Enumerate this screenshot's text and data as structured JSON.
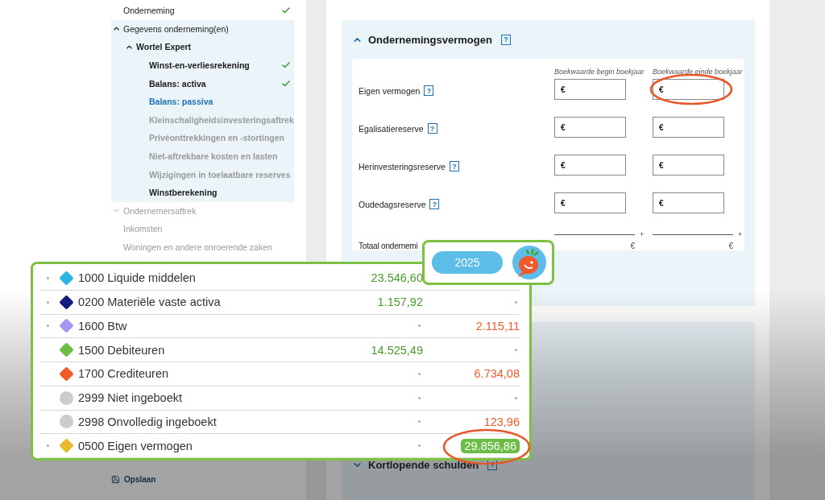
{
  "sidebar": {
    "items": [
      {
        "label": "Onderneming",
        "checked": true,
        "selected": false,
        "disabled": false
      },
      {
        "label": "Gegevens onderneming(en)",
        "expanded": true,
        "selected": false,
        "disabled": false,
        "children": [
          {
            "label": "Wortel Expert",
            "expanded": true,
            "selected": false,
            "disabled": false,
            "children": [
              {
                "label": "Winst-en-verliesrekening",
                "checked": true,
                "selected": false,
                "disabled": false
              },
              {
                "label": "Balans: activa",
                "checked": true,
                "selected": false,
                "disabled": false
              },
              {
                "label": "Balans: passiva",
                "checked": false,
                "selected": true,
                "disabled": false
              },
              {
                "label": "Kleinschaligheidsinvesteringsaftrek",
                "checked": false,
                "selected": false,
                "disabled": true
              },
              {
                "label": "Privéonttrekkingen en -stortingen",
                "checked": false,
                "selected": false,
                "disabled": true
              },
              {
                "label": "Niet-aftrekbare kosten en lasten",
                "checked": false,
                "selected": false,
                "disabled": true
              },
              {
                "label": "Wijzigingen in toelaatbare reserves",
                "checked": false,
                "selected": false,
                "disabled": true
              },
              {
                "label": "Winstberekening",
                "checked": false,
                "selected": false,
                "disabled": false
              }
            ]
          }
        ]
      },
      {
        "label": "Ondernemersaftrek",
        "expanded": false,
        "selected": false,
        "disabled": true
      },
      {
        "label": "Inkomsten",
        "selected": false,
        "disabled": true
      },
      {
        "label": "Woningen en andere onroerende zaken",
        "selected": false,
        "disabled": true
      }
    ],
    "save_label": "Opslaan"
  },
  "section": {
    "title": "Ondernemingsvermogen",
    "help": "?",
    "expanded": true,
    "columns": [
      "Boekwaarde begin boekjaar",
      "Boekwaarde einde boekjaar"
    ],
    "rows": [
      {
        "label": "Eigen vermogen",
        "help": "?",
        "fields": [
          {
            "prefix": "€",
            "circled": false
          },
          {
            "prefix": "€",
            "circled": true
          }
        ]
      },
      {
        "label": "Egalisatiereserve",
        "help": "?",
        "fields": [
          {
            "prefix": "€",
            "circled": false
          },
          {
            "prefix": "€",
            "circled": false
          }
        ]
      },
      {
        "label": "Herinvesteringsreserve",
        "help": "?",
        "fields": [
          {
            "prefix": "€",
            "circled": false
          },
          {
            "prefix": "€",
            "circled": false
          }
        ]
      },
      {
        "label": "Oudedagsreserve",
        "help": "?",
        "fields": [
          {
            "prefix": "€",
            "circled": false
          },
          {
            "prefix": "€",
            "circled": false
          }
        ]
      }
    ],
    "total": {
      "label": "Totaal ondernemi",
      "plus": "+",
      "currency": "€"
    }
  },
  "next_section": {
    "title": "Kortlopende schulden",
    "help": "?",
    "expanded": false
  },
  "year_card": {
    "year": "2025"
  },
  "accounts": [
    {
      "label": "1000 Liquide middelen",
      "kind": "diamond",
      "color": "#2bb5e0",
      "bullet": true,
      "debit": "23.546,60",
      "highlighted": false,
      "circled": false
    },
    {
      "label": "0200 Materiële vaste activa",
      "kind": "diamond",
      "color": "#141c7a",
      "bullet": true,
      "debit": "1.157,92",
      "highlighted": false,
      "circled": false
    },
    {
      "label": "1600 Btw",
      "kind": "diamond",
      "color": "#a39af0",
      "bullet": true,
      "credit": "2.115,11",
      "highlighted": false,
      "circled": false
    },
    {
      "label": "1500 Debiteuren",
      "kind": "diamond",
      "color": "#6cbd45",
      "bullet": false,
      "debit": "14.525,49",
      "highlighted": false,
      "circled": false
    },
    {
      "label": "1700 Crediteuren",
      "kind": "diamond",
      "color": "#f05a28",
      "bullet": false,
      "credit": "6.734,08",
      "highlighted": false,
      "circled": false
    },
    {
      "label": "2999 Niet ingeboekt",
      "kind": "circle",
      "color": "#cccccc",
      "bullet": false,
      "highlighted": false,
      "circled": false
    },
    {
      "label": "2998 Onvolledig ingeboekt",
      "kind": "circle",
      "color": "#cccccc",
      "bullet": false,
      "credit": "123,96",
      "highlighted": false,
      "circled": false
    },
    {
      "label": "0500 Eigen vermogen",
      "kind": "diamond",
      "color": "#e8b92a",
      "bullet": true,
      "credit": "29.856,86",
      "highlighted": true,
      "circled": true
    }
  ]
}
